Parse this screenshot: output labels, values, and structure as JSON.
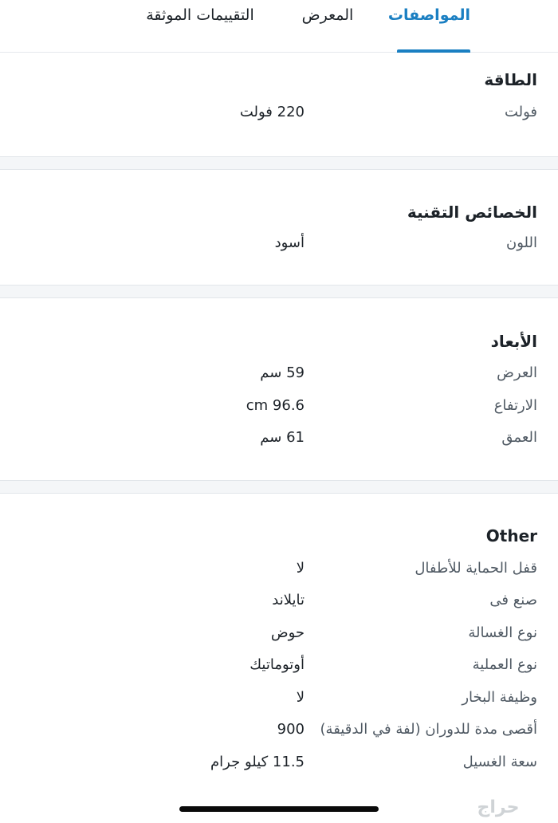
{
  "tabs": [
    {
      "label": "المواصفات",
      "active": true
    },
    {
      "label": "المعرض",
      "active": false
    },
    {
      "label": "التقييمات الموثقة",
      "active": false
    }
  ],
  "sections": [
    {
      "title": "الطاقة",
      "rows": [
        {
          "label": "فولت",
          "value": "220 فولت"
        }
      ]
    },
    {
      "title": "الخصائص التقنية",
      "rows": [
        {
          "label": "اللون",
          "value": "أسود"
        }
      ]
    },
    {
      "title": "الأبعاد",
      "rows": [
        {
          "label": "العرض",
          "value": "59 سم"
        },
        {
          "label": "الارتفاع",
          "value": "cm 96.6"
        },
        {
          "label": "العمق",
          "value": "61 سم"
        }
      ]
    },
    {
      "title": "Other",
      "rows": [
        {
          "label": "قفل الحماية للأطفال",
          "value": "لا"
        },
        {
          "label": "صنع فى",
          "value": "تايلاند"
        },
        {
          "label": "نوع الغسالة",
          "value": "حوض"
        },
        {
          "label": "نوع العملية",
          "value": "أوتوماتيك"
        },
        {
          "label": "وظيفة البخار",
          "value": "لا"
        },
        {
          "label": "أقصى مدة للدوران (لفة في الدقيقة)",
          "value": "900"
        },
        {
          "label": "سعة الغسيل",
          "value": "11.5 كيلو جرام"
        }
      ]
    }
  ],
  "watermark": "حراج",
  "colors": {
    "accent": "#1a7fc2",
    "separator": "#f4f6f8"
  }
}
